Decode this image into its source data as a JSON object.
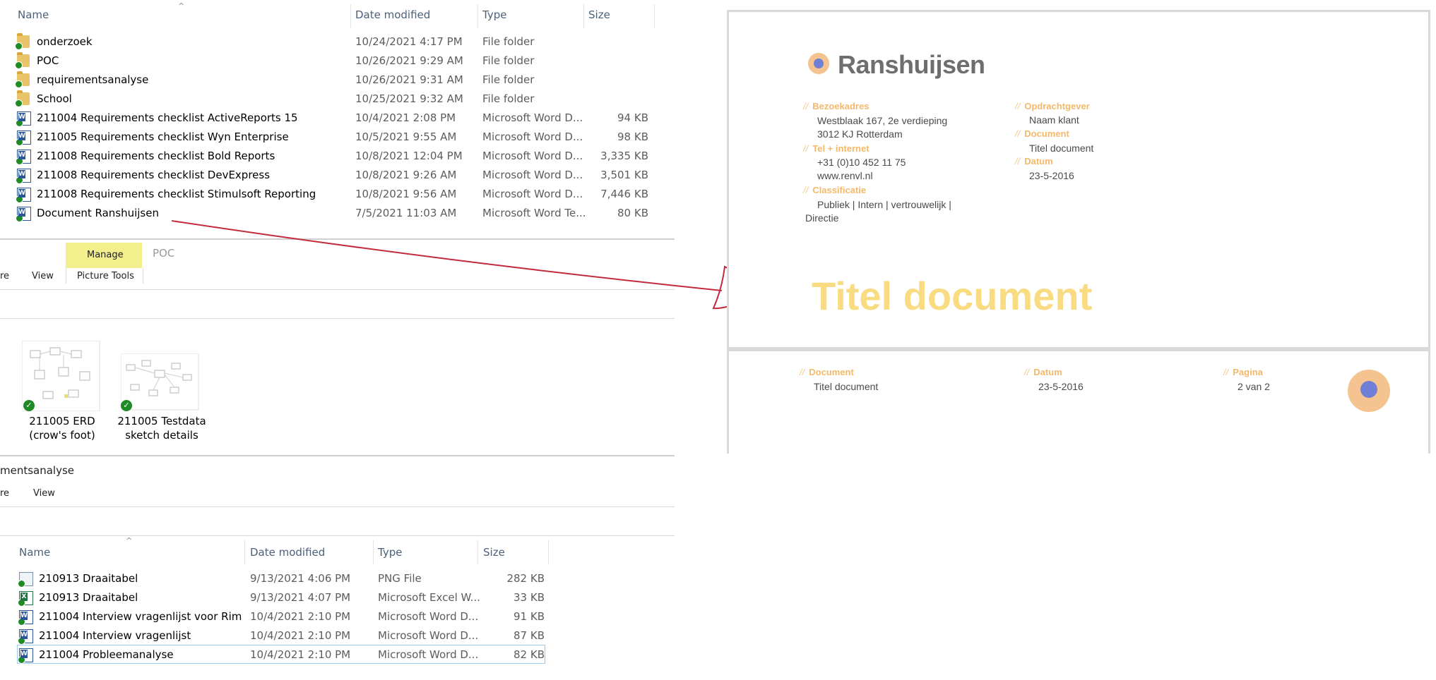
{
  "top_explorer": {
    "columns": [
      "Name",
      "Date modified",
      "Type",
      "Size"
    ],
    "rows": [
      {
        "name": "onderzoek",
        "date": "10/24/2021 4:17 PM",
        "type": "File folder",
        "size": "",
        "icon": "folder-icon"
      },
      {
        "name": "POC",
        "date": "10/26/2021 9:29 AM",
        "type": "File folder",
        "size": "",
        "icon": "folder-icon"
      },
      {
        "name": "requirementsanalyse",
        "date": "10/26/2021 9:31 AM",
        "type": "File folder",
        "size": "",
        "icon": "folder-icon"
      },
      {
        "name": "School",
        "date": "10/25/2021 9:32 AM",
        "type": "File folder",
        "size": "",
        "icon": "folder-icon"
      },
      {
        "name": "211004 Requirements checklist ActiveReports 15",
        "date": "10/4/2021 2:08 PM",
        "type": "Microsoft Word D...",
        "size": "94 KB",
        "icon": "word-icon"
      },
      {
        "name": "211005 Requirements checklist Wyn Enterprise",
        "date": "10/5/2021 9:55 AM",
        "type": "Microsoft Word D...",
        "size": "98 KB",
        "icon": "word-icon"
      },
      {
        "name": "211008 Requirements checklist Bold Reports",
        "date": "10/8/2021 12:04 PM",
        "type": "Microsoft Word D...",
        "size": "3,335 KB",
        "icon": "word-icon"
      },
      {
        "name": "211008 Requirements checklist DevExpress",
        "date": "10/8/2021 9:26 AM",
        "type": "Microsoft Word D...",
        "size": "3,501 KB",
        "icon": "word-icon"
      },
      {
        "name": "211008 Requirements checklist Stimulsoft Reporting",
        "date": "10/8/2021 9:56 AM",
        "type": "Microsoft Word D...",
        "size": "7,446 KB",
        "icon": "word-icon"
      },
      {
        "name": "Document Ranshuijsen",
        "date": "7/5/2021 11:03 AM",
        "type": "Microsoft Word Te...",
        "size": "80 KB",
        "icon": "word-icon"
      }
    ]
  },
  "middle_explorer": {
    "ribbon_tab_manage": "Manage",
    "ribbon_title": "POC",
    "ribbon_tab_share_fragment": "re",
    "ribbon_tab_view": "View",
    "ribbon_tab_picture_tools": "Picture Tools",
    "thumbnails": [
      {
        "line1": "211005 ERD",
        "line2": "(crow's foot)"
      },
      {
        "line1": "211005 Testdata",
        "line2": "sketch details"
      }
    ]
  },
  "bottom_explorer": {
    "title_fragment": "mentsanalyse",
    "ribbon_tab_share_fragment": "re",
    "ribbon_tab_view": "View",
    "columns": [
      "Name",
      "Date modified",
      "Type",
      "Size"
    ],
    "rows": [
      {
        "name": "210913 Draaitabel",
        "date": "9/13/2021 4:06 PM",
        "type": "PNG File",
        "size": "282 KB",
        "icon": "png-icon"
      },
      {
        "name": "210913 Draaitabel",
        "date": "9/13/2021 4:07 PM",
        "type": "Microsoft Excel W...",
        "size": "33 KB",
        "icon": "excel-icon"
      },
      {
        "name": "211004 Interview vragenlijst voor Rim",
        "date": "10/4/2021 2:10 PM",
        "type": "Microsoft Word D...",
        "size": "91 KB",
        "icon": "word-icon"
      },
      {
        "name": "211004 Interview vragenlijst",
        "date": "10/4/2021 2:10 PM",
        "type": "Microsoft Word D...",
        "size": "87 KB",
        "icon": "word-icon"
      },
      {
        "name": "211004 Probleemanalyse",
        "date": "10/4/2021 2:10 PM",
        "type": "Microsoft Word D...",
        "size": "82 KB",
        "icon": "word-icon"
      }
    ]
  },
  "document_preview": {
    "logo_text": "Ranshuijsen",
    "bezoekadres_label": "Bezoekadres",
    "bezoekadres_line1": "Westblaak 167, 2e verdieping",
    "bezoekadres_line2": "3012 KJ  Rotterdam",
    "tel_label": "Tel + internet",
    "tel_line1": "+31 (0)10 452 11 75",
    "tel_line2": "www.renvl.nl",
    "classificatie_label": "Classificatie",
    "classificatie_line1": "Publiek  |  Intern  |  vertrouwelijk  |",
    "classificatie_line2": "Directie",
    "opdrachtgever_label": "Opdrachtgever",
    "opdrachtgever_value": "Naam klant",
    "document_label": "Document",
    "document_value": "Titel document",
    "datum_label": "Datum",
    "datum_value": "23-5-2016",
    "big_title": "Titel document",
    "footer_document_label": "Document",
    "footer_document_value": "Titel document",
    "footer_datum_label": "Datum",
    "footer_datum_value": "23-5-2016",
    "footer_pagina_label": "Pagina",
    "footer_pagina_value": "2 van 2",
    "accent_color": "#f3b96a",
    "title_color": "#f9dc82",
    "logo_circle_color": "#6f7fd6"
  }
}
